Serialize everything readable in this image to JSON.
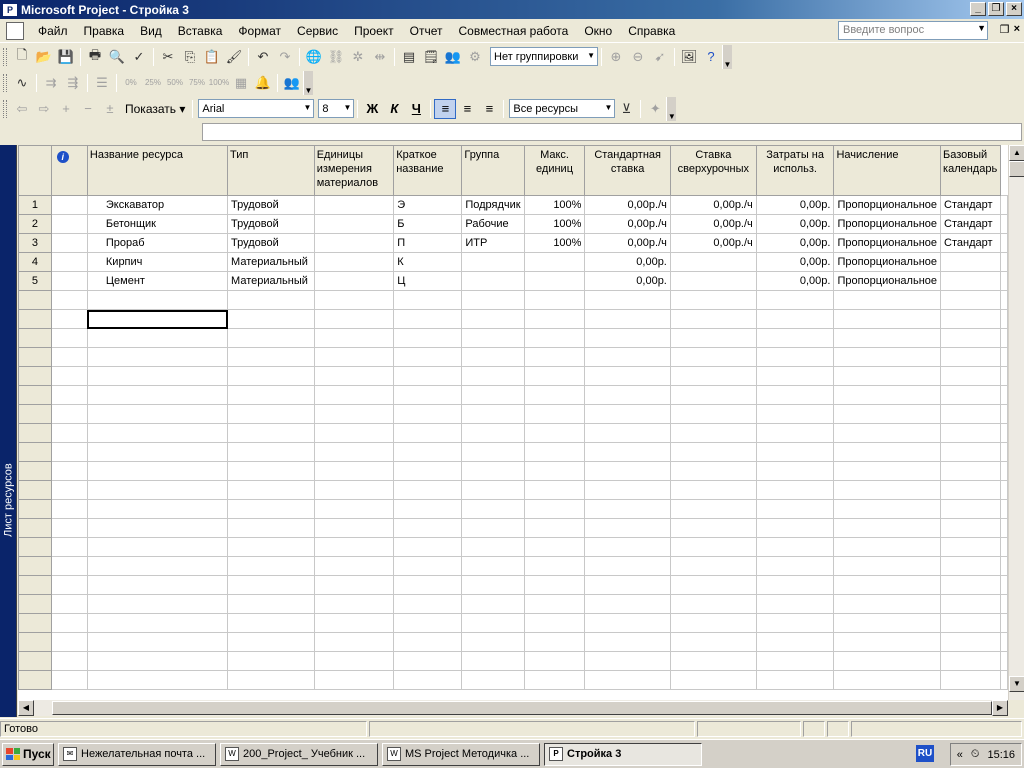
{
  "window": {
    "title": "Microsoft Project - Стройка  3"
  },
  "menu": {
    "items": [
      "Файл",
      "Правка",
      "Вид",
      "Вставка",
      "Формат",
      "Сервис",
      "Проект",
      "Отчет",
      "Совместная работа",
      "Окно",
      "Справка"
    ],
    "help_placeholder": "Введите вопрос"
  },
  "toolbar_standard": {
    "grouping": "Нет группировки"
  },
  "toolbar_formatting": {
    "show_label": "Показать",
    "font": "Arial",
    "font_size": "8",
    "bold": "Ж",
    "italic": "К",
    "underline": "Ч",
    "filter": "Все ресурсы"
  },
  "toolbar_tracking": {
    "percent_buttons": [
      "0%",
      "25%",
      "50%",
      "75%",
      "100%"
    ]
  },
  "viewbar": {
    "label": "Лист ресурсов"
  },
  "grid": {
    "columns": [
      {
        "key": "info",
        "label": ""
      },
      {
        "key": "name",
        "label": "Название ресурса"
      },
      {
        "key": "type",
        "label": "Тип"
      },
      {
        "key": "units",
        "label": "Единицы измерения материалов"
      },
      {
        "key": "initials",
        "label": "Краткое название"
      },
      {
        "key": "group",
        "label": "Группа"
      },
      {
        "key": "max",
        "label": "Макс. единиц"
      },
      {
        "key": "std_rate",
        "label": "Стандартная ставка"
      },
      {
        "key": "ovt_rate",
        "label": "Ставка сверхурочных"
      },
      {
        "key": "cost_use",
        "label": "Затраты на использ."
      },
      {
        "key": "accrue",
        "label": "Начисление"
      },
      {
        "key": "calendar",
        "label": "Базовый календарь"
      }
    ],
    "rows": [
      {
        "id": "1",
        "name": "Экскаватор",
        "type": "Трудовой",
        "units": "",
        "initials": "Э",
        "group": "Подрядчик",
        "max": "100%",
        "std_rate": "0,00р./ч",
        "ovt_rate": "0,00р./ч",
        "cost_use": "0,00р.",
        "accrue": "Пропорциональное",
        "calendar": "Стандарт"
      },
      {
        "id": "2",
        "name": "Бетонщик",
        "type": "Трудовой",
        "units": "",
        "initials": "Б",
        "group": "Рабочие",
        "max": "100%",
        "std_rate": "0,00р./ч",
        "ovt_rate": "0,00р./ч",
        "cost_use": "0,00р.",
        "accrue": "Пропорциональное",
        "calendar": "Стандарт"
      },
      {
        "id": "3",
        "name": "Прораб",
        "type": "Трудовой",
        "units": "",
        "initials": "П",
        "group": "ИТР",
        "max": "100%",
        "std_rate": "0,00р./ч",
        "ovt_rate": "0,00р./ч",
        "cost_use": "0,00р.",
        "accrue": "Пропорциональное",
        "calendar": "Стандарт"
      },
      {
        "id": "4",
        "name": "Кирпич",
        "type": "Материальный",
        "units": "",
        "initials": "К",
        "group": "",
        "max": "",
        "std_rate": "0,00р.",
        "ovt_rate": "",
        "cost_use": "0,00р.",
        "accrue": "Пропорциональное",
        "calendar": ""
      },
      {
        "id": "5",
        "name": "Цемент",
        "type": "Материальный",
        "units": "",
        "initials": "Ц",
        "group": "",
        "max": "",
        "std_rate": "0,00р.",
        "ovt_rate": "",
        "cost_use": "0,00р.",
        "accrue": "Пропорциональное",
        "calendar": ""
      }
    ],
    "empty_rows": 21
  },
  "status": {
    "text": "Готово"
  },
  "taskbar": {
    "start": "Пуск",
    "tasks": [
      "Нежелательная почта ...",
      "200_Project_ Учебник ...",
      "MS Project Методичка ...",
      "Стройка  3"
    ],
    "lang": "RU",
    "clock": "15:16"
  }
}
